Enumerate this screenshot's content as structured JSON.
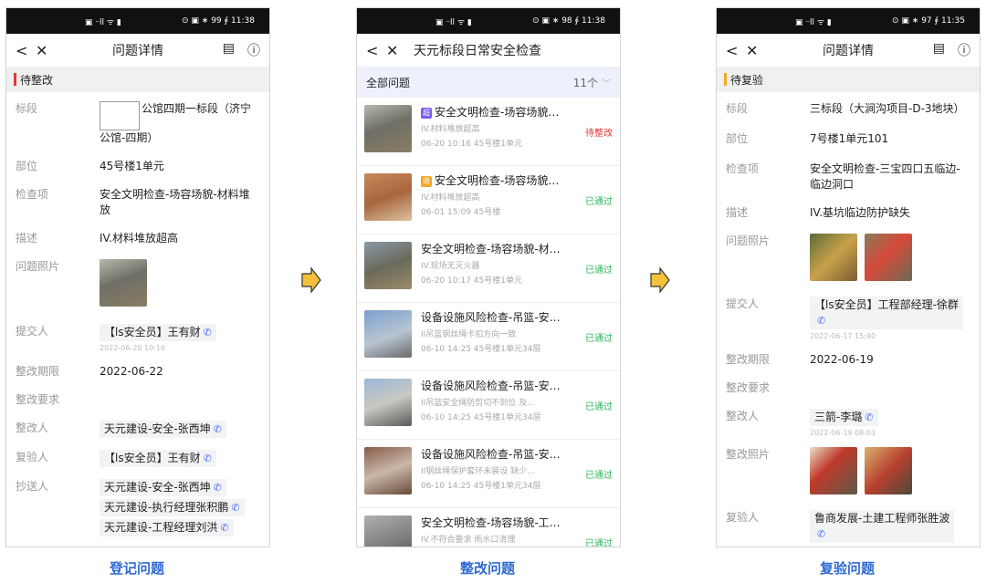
{
  "colors": {
    "accent_blue": "#2f6ad1",
    "status_red": "#e53935",
    "status_green": "#2fb45a",
    "stripe_red": "#e53935",
    "stripe_orange": "#f5a623",
    "arrow_fill": "#f3c23a"
  },
  "captions": [
    "登记问题",
    "整改问题",
    "复验问题"
  ],
  "left": {
    "statusbar": {
      "left": "▣ ᐧᐧll ᯤ ▮",
      "right": "⊙ ▣ ∗ 99 ∮ 11:38"
    },
    "nav": {
      "back": "<",
      "close": "✕",
      "title": "问题详情"
    },
    "section": "待整改",
    "fields": {
      "biaoduan_label": "标段",
      "biaoduan_value": "公馆四期一标段（济宁公馆-四期）",
      "buwei_label": "部位",
      "buwei_value": "45号楼1单元",
      "jiancha_label": "检查项",
      "jiancha_value": "安全文明检查-场容场貌-材料堆放",
      "miaoshu_label": "描述",
      "miaoshu_value": "IV.材料堆放超高",
      "photo_label": "问题照片",
      "submitter_label": "提交人",
      "submitter_value": "【ls安全员】王有财",
      "submitter_time": "2022-06-20 10:16",
      "deadline_label": "整改期限",
      "deadline_value": "2022-06-22",
      "require_label": "整改要求",
      "rectifier_label": "整改人",
      "rectifier_value": "天元建设-安全-张西坤",
      "reviewer_label": "复验人",
      "reviewer_value": "【ls安全员】王有财",
      "cc_label": "抄送人",
      "cc_values": [
        "天元建设-安全-张西坤",
        "天元建设-执行经理张积鹏",
        "天元建设-工程经理刘洪"
      ]
    }
  },
  "middle": {
    "statusbar": {
      "left": "▣ ᐧᐧll ᯤ ▮",
      "right": "⊙ ▣ ∗ 98 ∮ 11:38"
    },
    "nav": {
      "back": "<",
      "close": "✕",
      "title": "天元标段日常安全检查"
    },
    "filter": {
      "label": "全部问题",
      "count": "11个"
    },
    "items": [
      {
        "badge": "超",
        "badge_color": "#7b5cf0",
        "title": "安全文明检查-场容场貌…",
        "sub": "IV.材料堆放超高",
        "meta": "06-20 10:16 45号楼1单元",
        "status": "待整改",
        "status_color": "#e53935"
      },
      {
        "badge": "退",
        "badge_color": "#f5a623",
        "title": "安全文明检查-场容场貌…",
        "sub": "IV.材料堆放超高",
        "meta": "06-01 15:09 45号楼",
        "status": "已通过",
        "status_color": "#2fb45a"
      },
      {
        "badge": "",
        "badge_color": "",
        "title": "安全文明检查-场容场貌-材…",
        "sub": "IV.现场无灭火器",
        "meta": "06-20 10:17 45号楼1单元",
        "status": "已通过",
        "status_color": "#2fb45a"
      },
      {
        "badge": "",
        "badge_color": "",
        "title": "设备设施风险检查-吊篮-安…",
        "sub": "II吊篮钢丝绳卡扣方向一致",
        "meta": "06-10 14:25 45号楼1单元34层",
        "status": "已通过",
        "status_color": "#2fb45a"
      },
      {
        "badge": "",
        "badge_color": "",
        "title": "设备设施风险检查-吊篮-安…",
        "sub": "II吊篮安全绳防剪切不到位 及…",
        "meta": "06-10 14:25 45号楼1单元34层",
        "status": "已通过",
        "status_color": "#2fb45a"
      },
      {
        "badge": "",
        "badge_color": "",
        "title": "设备设施风险检查-吊篮-安…",
        "sub": "II钢丝绳保护套环未装设 缺少…",
        "meta": "06-10 14:25 45号楼1单元34层",
        "status": "已通过",
        "status_color": "#2fb45a"
      },
      {
        "badge": "",
        "badge_color": "",
        "title": "安全文明检查-场容场貌-工…",
        "sub": "IV.不符合要求 雨水口清理",
        "meta": "",
        "status": "已通过",
        "status_color": "#2fb45a"
      }
    ]
  },
  "right": {
    "statusbar": {
      "left": "▣ ᐧᐧll ᯤ ▮",
      "right": "⊙ ▣ ∗ 97 ∮ 11:35"
    },
    "nav": {
      "back": "<",
      "close": "✕",
      "title": "问题详情"
    },
    "section": "待复验",
    "fields": {
      "biaoduan_label": "标段",
      "biaoduan_value": "三标段（大涧沟项目-D-3地块）",
      "buwei_label": "部位",
      "buwei_value": "7号楼1单元101",
      "jiancha_label": "检查项",
      "jiancha_value": "安全文明检查-三宝四口五临边-临边洞口",
      "miaoshu_label": "描述",
      "miaoshu_value": "IV.基坑临边防护缺失",
      "photo_label": "问题照片",
      "submitter_label": "提交人",
      "submitter_value": "【ls安全员】工程部经理-徐群",
      "submitter_time": "2022-06-17 15:40",
      "deadline_label": "整改期限",
      "deadline_value": "2022-06-19",
      "require_label": "整改要求",
      "rectifier_label": "整改人",
      "rectifier_value": "三箭-李璐",
      "rectifier_time": "2022-06-19 08:03",
      "rect_photo_label": "整改照片",
      "reviewer_label": "复验人",
      "reviewer_value": "鲁商发展-土建工程师张胜波"
    }
  }
}
